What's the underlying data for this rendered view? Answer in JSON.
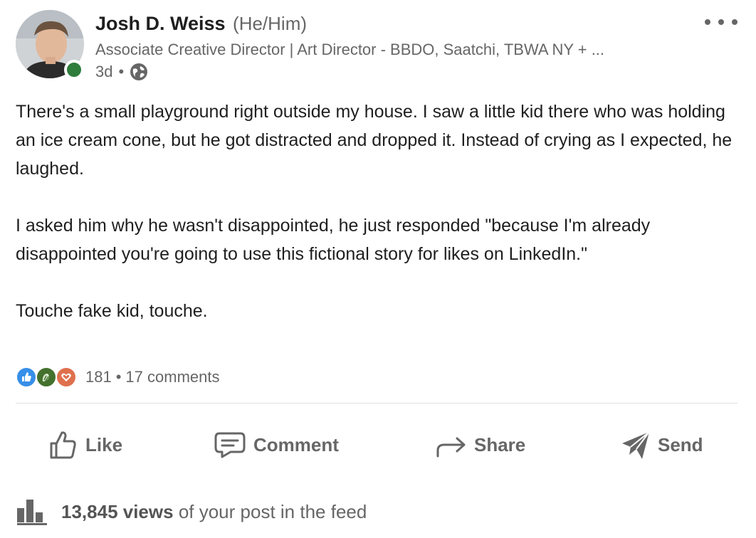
{
  "author": {
    "name": "Josh D. Weiss",
    "pronouns": "(He/Him)",
    "headline": "Associate Creative Director | Art Director - BBDO, Saatchi, TBWA NY + ...",
    "time": "3d",
    "separator": "•",
    "visibility_icon": "globe-icon",
    "online_status_color": "#2e7d3d"
  },
  "post": {
    "paragraphs": [
      "There's a small playground right outside my house. I saw a little kid there who was holding an ice cream cone, but he got distracted and dropped it. Instead of crying as I expected, he laughed.",
      "I asked him why he wasn't disappointed, he just responded \"because I'm already disappointed you're going to use this fictional story for likes on LinkedIn.\"",
      "Touche fake kid, touche."
    ]
  },
  "social": {
    "reactions": [
      "like-reaction-icon",
      "celebrate-reaction-icon",
      "love-reaction-icon"
    ],
    "reaction_count": "181",
    "separator": "•",
    "comments": "17 comments"
  },
  "actions": {
    "like": "Like",
    "comment": "Comment",
    "share": "Share",
    "send": "Send"
  },
  "analytics": {
    "views_count": "13,845 views",
    "views_suffix": "of your post in the feed"
  },
  "colors": {
    "text_primary": "#1f1f1f",
    "text_secondary": "#666666",
    "like_blue": "#378fe9",
    "celebrate_green": "#44712e",
    "love_orange": "#df704d"
  }
}
